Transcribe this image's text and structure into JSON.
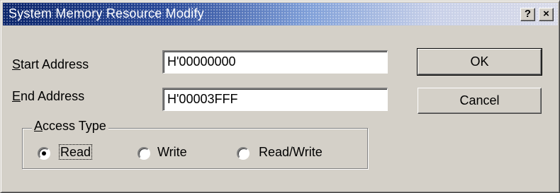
{
  "window": {
    "title": "System Memory Resource Modify",
    "help_glyph": "?",
    "close_glyph": "×"
  },
  "form": {
    "start_address": {
      "label_mnemonic": "S",
      "label_rest": "tart Address",
      "value": "H'00000000"
    },
    "end_address": {
      "label_mnemonic": "E",
      "label_rest": "nd Address",
      "value": "H'00003FFF"
    }
  },
  "buttons": {
    "ok": "OK",
    "cancel": "Cancel"
  },
  "access_type": {
    "legend_mnemonic": "A",
    "legend_rest": "ccess Type",
    "options": [
      {
        "label": "Read",
        "selected": true
      },
      {
        "label": "Write",
        "selected": false
      },
      {
        "label": "Read/Write",
        "selected": false
      }
    ]
  },
  "colors": {
    "title_start": "#0a246a",
    "face": "#d4d0c8"
  }
}
